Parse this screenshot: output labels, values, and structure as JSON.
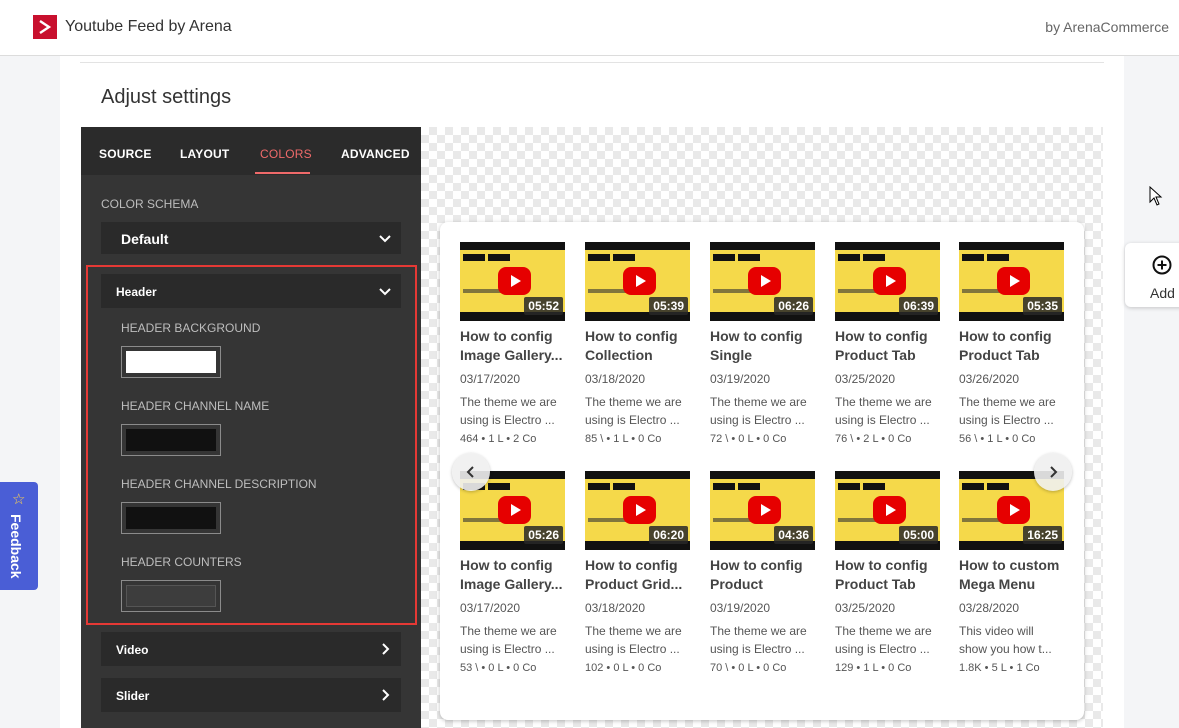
{
  "app": {
    "title": "Youtube Feed by Arena",
    "by": "by ArenaCommerce"
  },
  "page": {
    "title": "Adjust settings"
  },
  "tabs": [
    {
      "label": "SOURCE",
      "active": false
    },
    {
      "label": "LAYOUT",
      "active": false
    },
    {
      "label": "COLORS",
      "active": true
    },
    {
      "label": "ADVANCED",
      "active": false
    }
  ],
  "colors": {
    "schema_label": "COLOR SCHEMA",
    "schema_value": "Default",
    "header_section": "Header",
    "fields": [
      {
        "label": "HEADER BACKGROUND",
        "color": "#ffffff"
      },
      {
        "label": "HEADER CHANNEL NAME",
        "color": "#111111"
      },
      {
        "label": "HEADER CHANNEL DESCRIPTION",
        "color": "#111111"
      },
      {
        "label": "HEADER COUNTERS",
        "color": "#3d3d3d"
      }
    ],
    "sections": [
      "Video",
      "Slider"
    ]
  },
  "videos": [
    {
      "title": "How to config Image Gallery...",
      "duration": "05:52",
      "date": "03/17/2020",
      "desc": "The theme we are using is Electro ...",
      "meta": "464 • 1 L • 2 Co"
    },
    {
      "title": "How to config Collection List...",
      "duration": "05:39",
      "date": "03/18/2020",
      "desc": "The theme we are using is Electro ...",
      "meta": "85 \\ • 1 L • 0 Co"
    },
    {
      "title": "How to config Single Product...",
      "duration": "06:26",
      "date": "03/19/2020",
      "desc": "The theme we are using is Electro ...",
      "meta": "72 \\ • 0 L • 0 Co"
    },
    {
      "title": "How to config Product Tab V...",
      "duration": "06:39",
      "date": "03/25/2020",
      "desc": "The theme we are using is Electro ...",
      "meta": "76 \\ • 2 L • 0 Co"
    },
    {
      "title": "How to config Product Tab V...",
      "duration": "05:35",
      "date": "03/26/2020",
      "desc": "The theme we are using is Electro ...",
      "meta": "56 \\ • 1 L • 0 Co"
    },
    {
      "title": "How to config Image Gallery...",
      "duration": "05:26",
      "date": "03/17/2020",
      "desc": "The theme we are using is Electro ...",
      "meta": "53 \\ • 0 L • 0 Co"
    },
    {
      "title": "How to config Product Grid...",
      "duration": "06:20",
      "date": "03/18/2020",
      "desc": "The theme we are using is Electro ...",
      "meta": "102 • 0 L • 0 Co"
    },
    {
      "title": "How to config Product Listin...",
      "duration": "04:36",
      "date": "03/19/2020",
      "desc": "The theme we are using is Electro ...",
      "meta": "70 \\ • 0 L • 0 Co"
    },
    {
      "title": "How to config Product Tab V...",
      "duration": "05:00",
      "date": "03/25/2020",
      "desc": "The theme we are using is Electro ...",
      "meta": "129 • 1 L • 0 Co"
    },
    {
      "title": "How to custom Mega Menu in...",
      "duration": "16:25",
      "date": "03/28/2020",
      "desc": "This video will show you how t...",
      "meta": "1.8K • 5 L • 1 Co"
    }
  ],
  "add_widget": {
    "label": "Add"
  },
  "feedback": {
    "label": "Feedback"
  }
}
